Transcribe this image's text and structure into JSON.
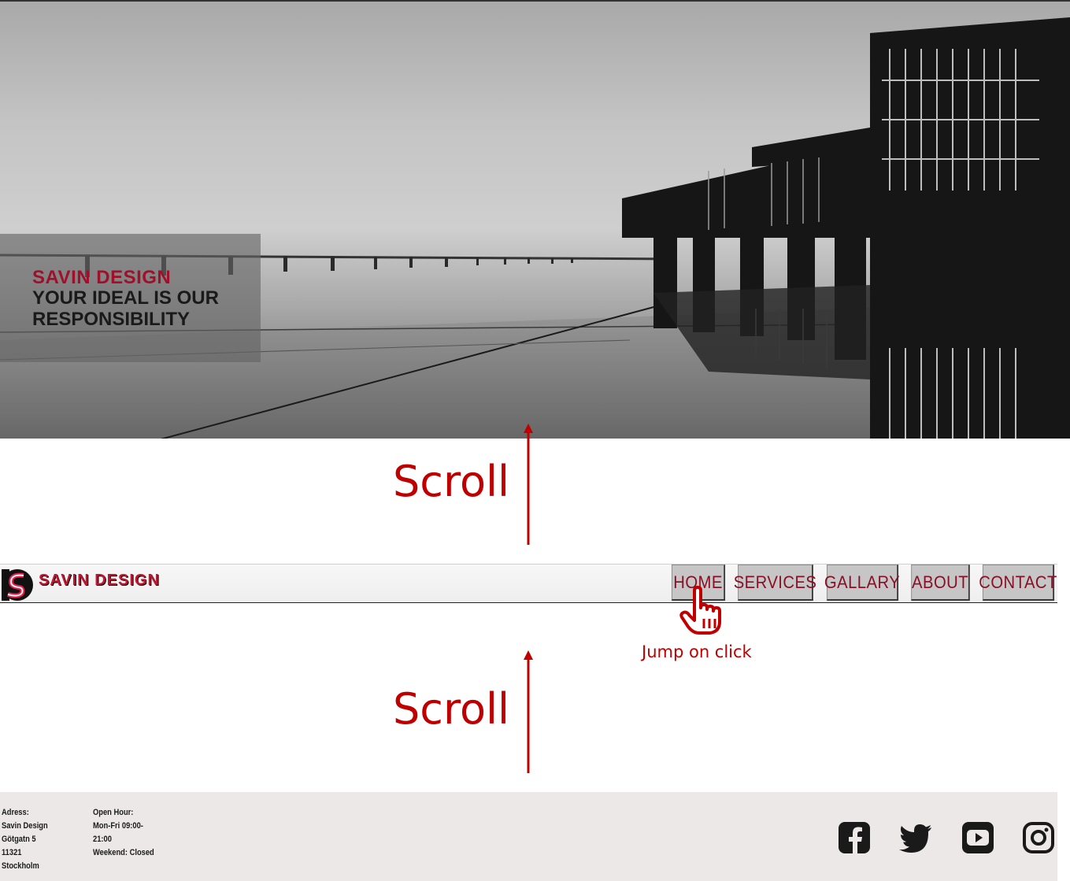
{
  "hero": {
    "brand": "SAVIN DESIGN",
    "tagline": "YOUR IDEAL IS OUR RESPONSIBILITY"
  },
  "annotations": {
    "scroll_top": "Scroll",
    "scroll_bottom": "Scroll",
    "jump": "Jump on click",
    "color": "#c00000"
  },
  "navbar": {
    "logo_text_1": "SAVIN",
    "logo_text_2": "DESIGN",
    "items": [
      {
        "label": "HOME"
      },
      {
        "label": "SERVICES"
      },
      {
        "label": "GALLARY"
      },
      {
        "label": "ABOUT"
      },
      {
        "label": "CONTACT"
      }
    ]
  },
  "footer": {
    "address_title": "Adress:",
    "address_lines": [
      "Savin Design",
      "Götgatn 5",
      "11321",
      "Stockholm"
    ],
    "hours_title": "Open Hour:",
    "hours_lines": [
      "Mon-Fri 09:00-",
      "21:00",
      "Weekend: Closed"
    ],
    "social_icons": [
      "facebook-icon",
      "twitter-icon",
      "youtube-icon",
      "instagram-icon"
    ]
  },
  "colors": {
    "accent": "#a0102a",
    "nav_text": "#8a0f26",
    "nav_bg": "#c6c6c6",
    "footer_bg": "#ece8e8"
  }
}
